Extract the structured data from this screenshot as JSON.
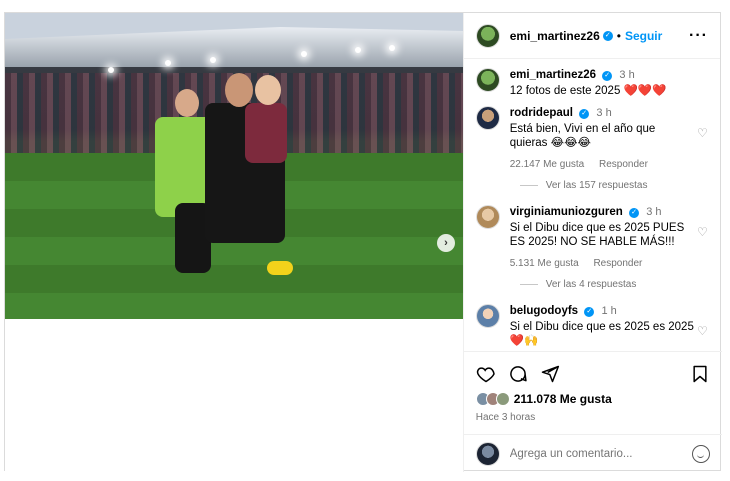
{
  "header": {
    "username": "emi_martinez26",
    "verified": true,
    "follow_label": "Seguir",
    "more_icon": "more-options-icon"
  },
  "caption": {
    "username": "emi_martinez26",
    "time": "3 h",
    "text": "12 fotos de este 2025 ❤️❤️❤️"
  },
  "comments": [
    {
      "username": "rodridepaul",
      "time": "3 h",
      "text": "Está bien, Vivi en el año que quieras 😂😂😂",
      "likes": "22.147 Me gusta",
      "reply_label": "Responder",
      "view_replies": "Ver las 157 respuestas"
    },
    {
      "username": "virginiamuniozguren",
      "time": "3 h",
      "text": "Si el Dibu dice que es 2025 PUES ES 2025! NO SE HABLE MÁS!!!",
      "likes": "5.131 Me gusta",
      "reply_label": "Responder",
      "view_replies": "Ver las 4 respuestas"
    },
    {
      "username": "belugodoyfs",
      "time": "1 h",
      "text": "Si el Dibu dice que es 2025 es 2025 ❤️🙌"
    }
  ],
  "actions": {
    "likes": "211.078 Me gusta",
    "posted": "Hace 3 horas"
  },
  "composer": {
    "placeholder": "Agrega un comentario..."
  },
  "colors": {
    "accent": "#0095f6",
    "muted": "#737373",
    "border": "#dbdbdb"
  }
}
